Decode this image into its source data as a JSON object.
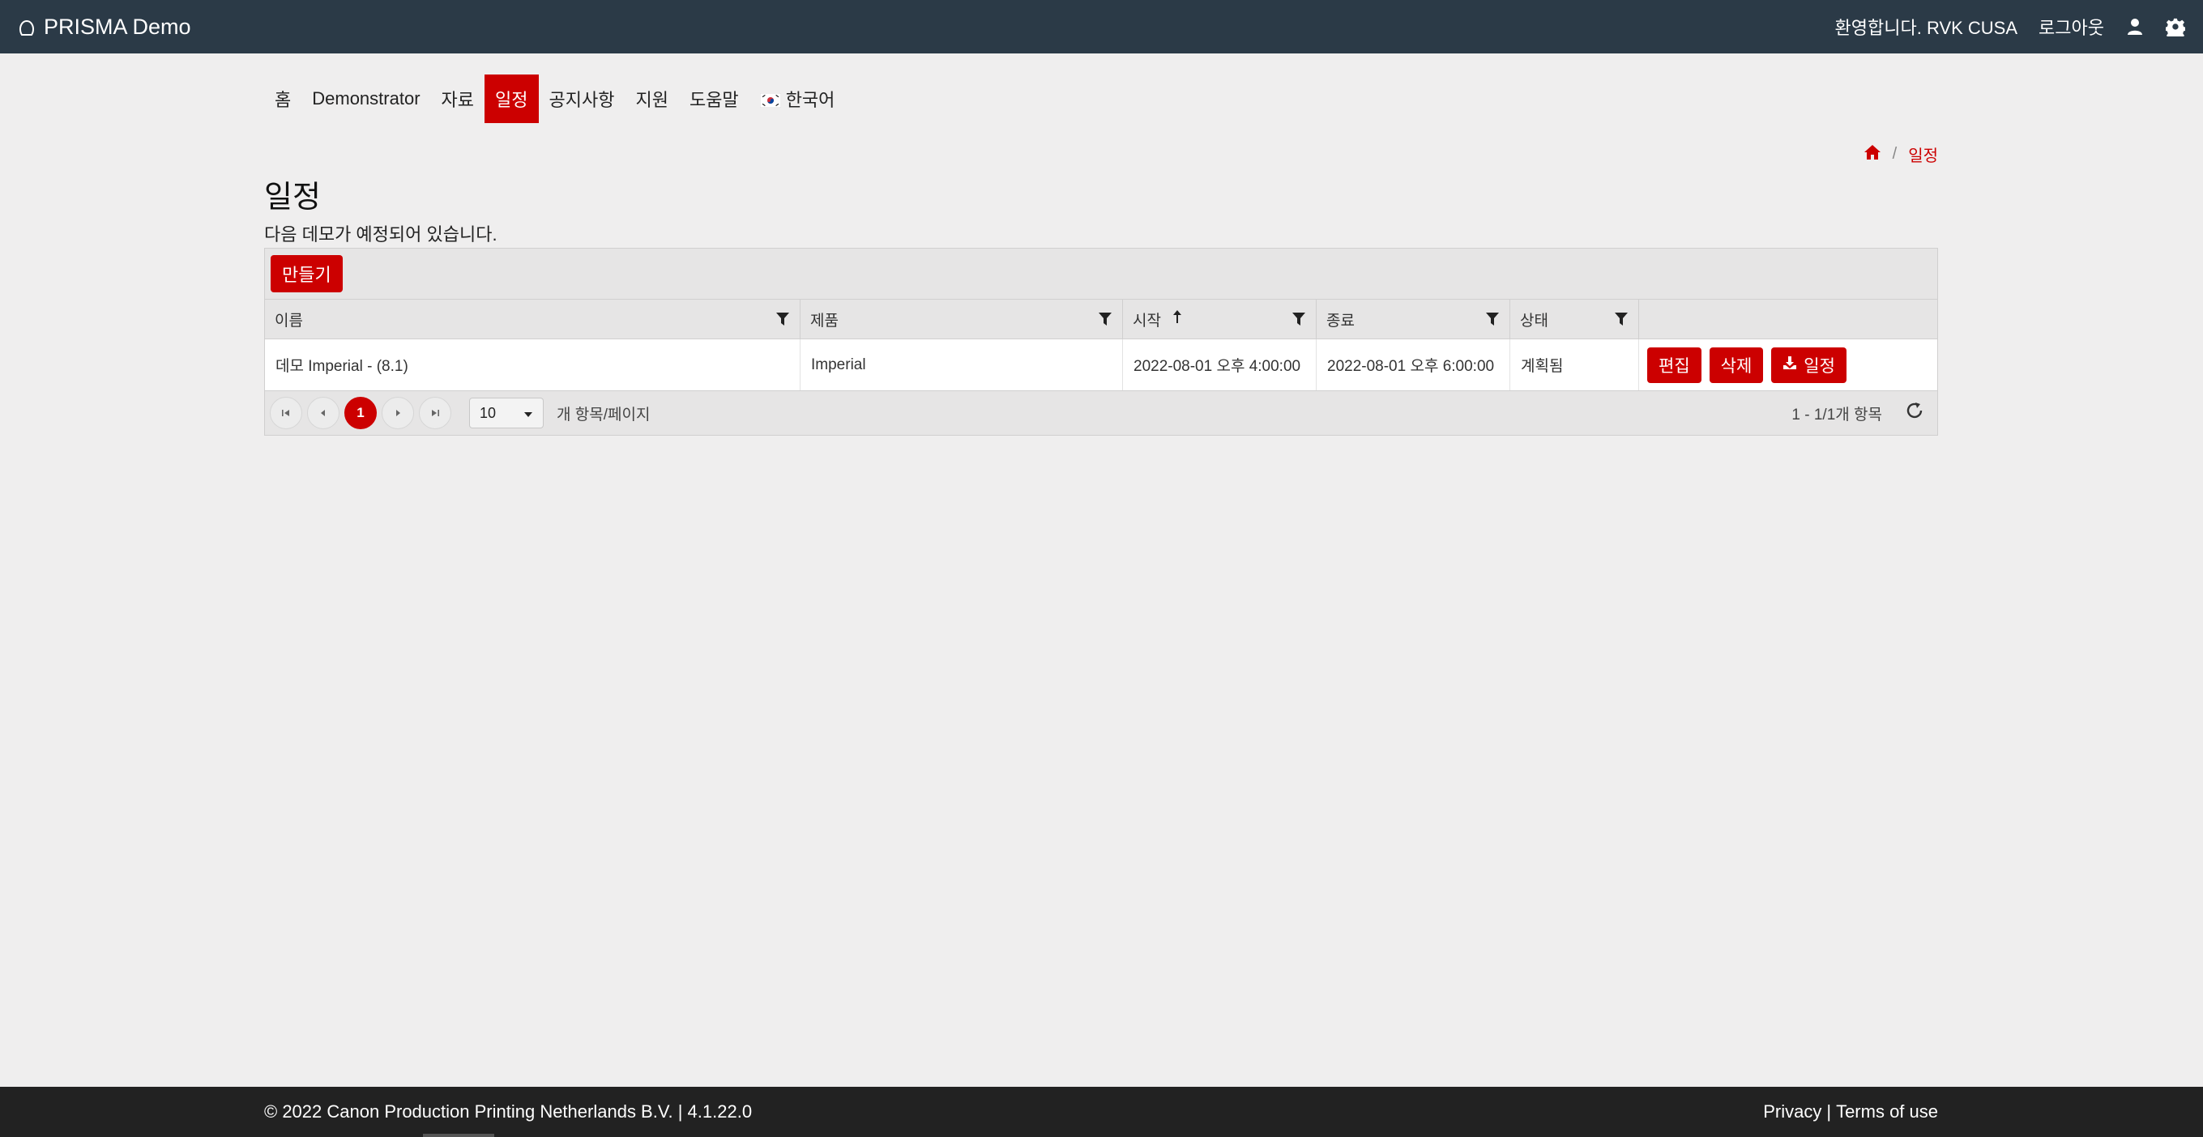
{
  "app": {
    "title": "PRISMA Demo"
  },
  "topbar": {
    "welcome": "환영합니다. RVK CUSA",
    "logout": "로그아웃",
    "user_icon": "user-icon",
    "settings_icon": "gear-icon"
  },
  "nav": {
    "items": [
      {
        "label": "홈"
      },
      {
        "label": "Demonstrator"
      },
      {
        "label": "자료"
      },
      {
        "label": "일정",
        "active": true
      },
      {
        "label": "공지사항"
      },
      {
        "label": "지원"
      },
      {
        "label": "도움말"
      }
    ],
    "language": "한국어"
  },
  "breadcrumb": {
    "current": "일정"
  },
  "page": {
    "title": "일정",
    "subtitle": "다음 데모가 예정되어 있습니다.",
    "create_label": "만들기"
  },
  "table": {
    "columns": [
      "이름",
      "제품",
      "시작",
      "종료",
      "상태"
    ],
    "rows": [
      {
        "name": "데모 Imperial - (8.1)",
        "product": "Imperial",
        "start": "2022-08-01 오후 4:00:00",
        "end": "2022-08-01 오후 6:00:00",
        "status": "계획됨"
      }
    ],
    "actions": {
      "edit": "편집",
      "delete": "삭제",
      "schedule": "일정"
    }
  },
  "pager": {
    "current_page": "1",
    "page_size": "10",
    "per_page_label": "개 항목/페이지",
    "summary": "1 - 1/1개 항목"
  },
  "footer": {
    "copyright": "© 2022 Canon Production Printing Netherlands B.V. | 4.1.22.0",
    "privacy": "Privacy",
    "separator": "|",
    "terms": "Terms of use"
  },
  "colors": {
    "accent": "#cc0000",
    "topbar": "#2b3a47",
    "footer": "#222222"
  }
}
